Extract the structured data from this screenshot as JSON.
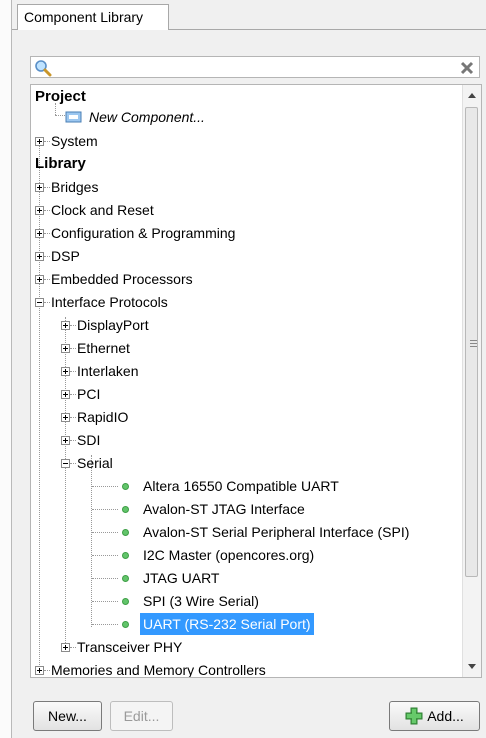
{
  "panel": {
    "tab_label": "Component Library"
  },
  "search": {
    "placeholder": ""
  },
  "tree": {
    "project_header": "Project",
    "new_component": "New Component...",
    "system": "System",
    "library_header": "Library",
    "library_items": [
      "Bridges",
      "Clock and Reset",
      "Configuration & Programming",
      "DSP",
      "Embedded Processors"
    ],
    "interface_protocols": "Interface Protocols",
    "protocol_items": [
      "DisplayPort",
      "Ethernet",
      "Interlaken",
      "PCI",
      "RapidIO",
      "SDI"
    ],
    "serial": "Serial",
    "serial_items": [
      "Altera 16550 Compatible UART",
      "Avalon-ST JTAG Interface",
      "Avalon-ST Serial Peripheral Interface (SPI)",
      "I2C Master (opencores.org)",
      "JTAG UART",
      "SPI (3 Wire Serial)"
    ],
    "selected_item": "UART (RS-232 Serial Port)",
    "transceiver": "Transceiver PHY",
    "memories": "Memories and Memory Controllers"
  },
  "buttons": {
    "new": "New...",
    "edit": "Edit...",
    "add": "Add..."
  },
  "colors": {
    "selection": "#3399ff",
    "add_icon": "#4caf50",
    "bullet": "#62c46a"
  }
}
